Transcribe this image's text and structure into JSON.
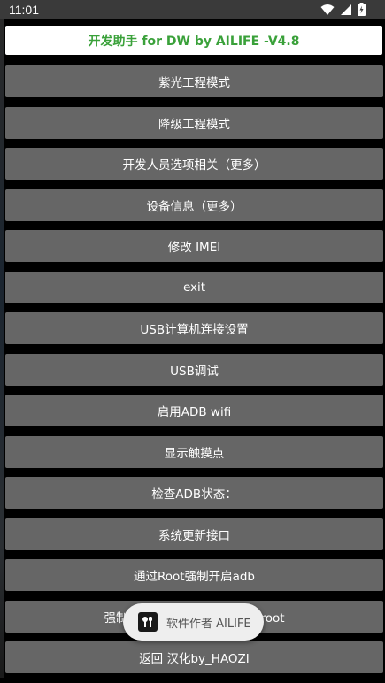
{
  "status_bar": {
    "time": "11:01",
    "icons": [
      "wifi-icon",
      "signal-icon",
      "battery-icon"
    ]
  },
  "header": {
    "title": "开发助手 for DW by AILIFE -V4.8",
    "title_color": "#3aa13a"
  },
  "buttons": [
    {
      "label": "紫光工程模式"
    },
    {
      "label": "降级工程模式"
    },
    {
      "label": "开发人员选项相关（更多）"
    },
    {
      "label": "设备信息（更多）"
    },
    {
      "label": "修改 IMEI"
    },
    {
      "label": "exit"
    },
    {
      "label": "USB计算机连接设置"
    },
    {
      "label": "USB调试"
    },
    {
      "label": "启用ADB wifi"
    },
    {
      "label": "显示触摸点"
    },
    {
      "label": "检查ADB状态："
    },
    {
      "label": "系统更新接口"
    },
    {
      "label": "通过Root强制开启adb"
    },
    {
      "label": "强制通过Root开启adb shell root"
    },
    {
      "label": "返回 汉化by_HAOZI"
    }
  ],
  "toast": {
    "text": "软件作者 AILIFE",
    "icon": "app-icon"
  },
  "colors": {
    "background": "#000000",
    "button": "#666666",
    "button_text": "#ffffff",
    "toast_bg": "#eeeeee"
  }
}
